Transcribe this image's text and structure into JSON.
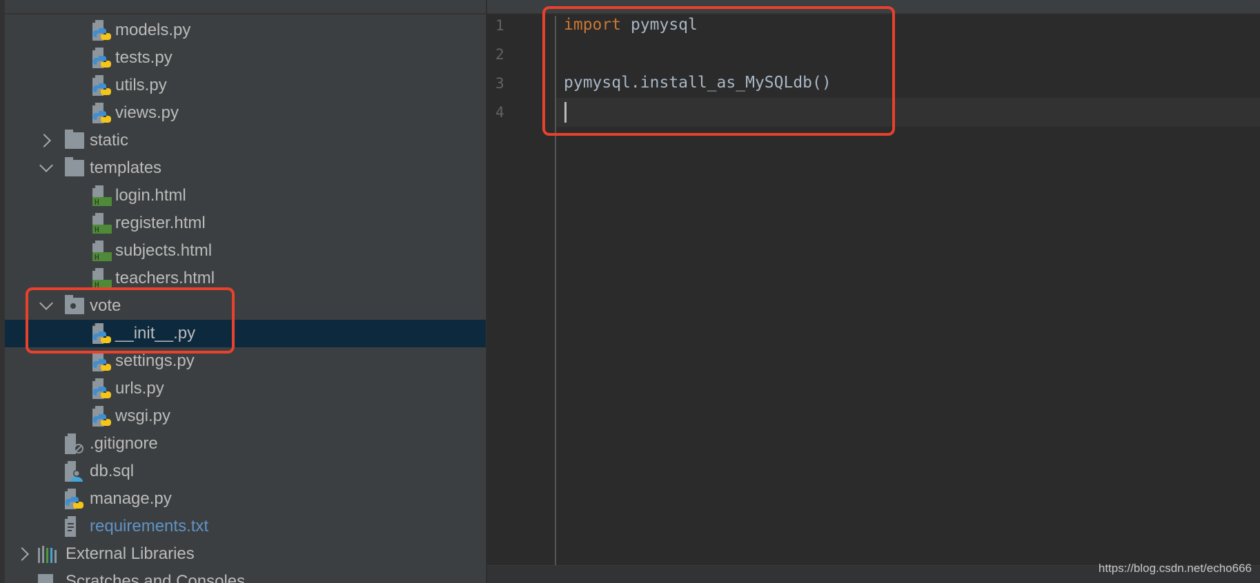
{
  "project_tree": {
    "items": [
      {
        "label": "models.py",
        "type": "python",
        "depth": 3
      },
      {
        "label": "tests.py",
        "type": "python",
        "depth": 3
      },
      {
        "label": "utils.py",
        "type": "python",
        "depth": 3
      },
      {
        "label": "views.py",
        "type": "python",
        "depth": 3
      },
      {
        "label": "static",
        "type": "folder",
        "depth": 2,
        "expanded": false
      },
      {
        "label": "templates",
        "type": "folder",
        "depth": 2,
        "expanded": true
      },
      {
        "label": "login.html",
        "type": "html",
        "depth": 3
      },
      {
        "label": "register.html",
        "type": "html",
        "depth": 3
      },
      {
        "label": "subjects.html",
        "type": "html",
        "depth": 3
      },
      {
        "label": "teachers.html",
        "type": "html",
        "depth": 3
      },
      {
        "label": "vote",
        "type": "package",
        "depth": 2,
        "expanded": true
      },
      {
        "label": "__init__.py",
        "type": "python",
        "depth": 3,
        "selected": true
      },
      {
        "label": "settings.py",
        "type": "python",
        "depth": 3
      },
      {
        "label": "urls.py",
        "type": "python",
        "depth": 3
      },
      {
        "label": "wsgi.py",
        "type": "python",
        "depth": 3
      },
      {
        "label": ".gitignore",
        "type": "ignore",
        "depth": 2
      },
      {
        "label": "db.sql",
        "type": "sql",
        "depth": 2
      },
      {
        "label": "manage.py",
        "type": "python",
        "depth": 2
      },
      {
        "label": "requirements.txt",
        "type": "text",
        "depth": 2,
        "link": true
      },
      {
        "label": "External Libraries",
        "type": "libraries",
        "depth": 1,
        "expanded": false
      },
      {
        "label": "Scratches and Consoles",
        "type": "scratches",
        "depth": 1
      }
    ]
  },
  "editor": {
    "lines": [
      {
        "num": "1",
        "keyword": "import",
        "rest": " pymysql"
      },
      {
        "num": "2",
        "keyword": "",
        "rest": ""
      },
      {
        "num": "3",
        "keyword": "",
        "rest": "pymysql.install_as_MySQLdb()"
      },
      {
        "num": "4",
        "keyword": "",
        "rest": ""
      }
    ],
    "current_line": 4
  },
  "watermark": "https://blog.csdn.net/echo666",
  "colors": {
    "highlight_box": "#e8412c",
    "keyword": "#cc7832",
    "selection": "#0d293e",
    "link": "#5f94c6"
  }
}
